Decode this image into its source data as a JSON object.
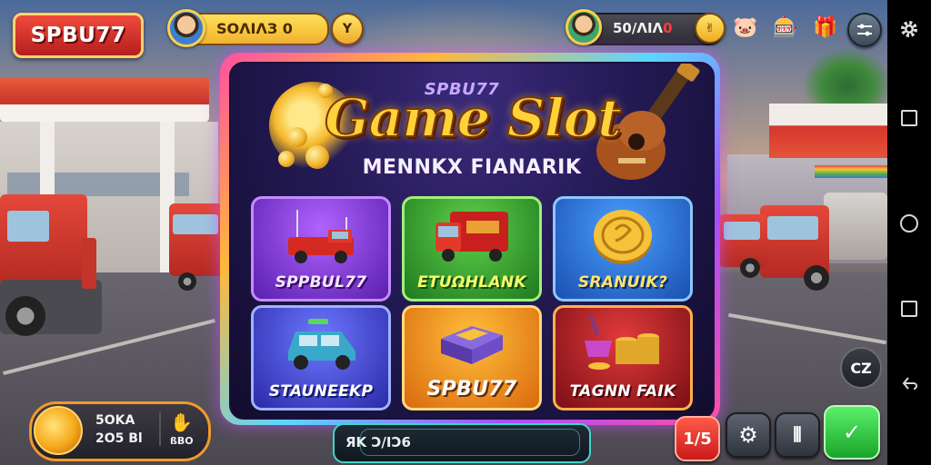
{
  "brand": {
    "logo_text": "SPBU77",
    "panel_brand": "SPBU77"
  },
  "header": {
    "coins": "SOΛΙΛЗ 0",
    "dropdown_glyph": "Y",
    "balance_main": "50/ΛΙΛ",
    "balance_suffix": "0",
    "small_btn_glyph": "✌"
  },
  "top_icons": [
    {
      "name": "piggy-bank-icon",
      "glyph": "🐷"
    },
    {
      "name": "slot-machine-icon",
      "glyph": "🎰"
    },
    {
      "name": "gift-icon",
      "glyph": "🎁"
    }
  ],
  "panel": {
    "title": "Game Slot",
    "subtitle": "MENNKX FIANARIK"
  },
  "tiles": [
    {
      "label": "SPPBUL77",
      "icon": "fire-truck-icon"
    },
    {
      "label": "ETUΩHLANK",
      "icon": "delivery-truck-icon"
    },
    {
      "label": "SRANUIΚ?",
      "icon": "gold-coin-icon"
    },
    {
      "label": "STAUNEEKP",
      "icon": "suv-car-icon"
    },
    {
      "label": "SPBU77",
      "icon": "gold-bar-box-icon"
    },
    {
      "label": "TAGNN FAIK",
      "icon": "coin-stack-icon"
    }
  ],
  "bonus": {
    "line1": "5OKA",
    "line2": "2O5 Bl",
    "line3": "ßBO"
  },
  "chat": {
    "text": "ЯK Ɔ/IƆ6"
  },
  "side_badge": "CZ",
  "bottom_buttons": {
    "red": "1/5",
    "gear": "⚙",
    "bars": "⦀",
    "green": "✓"
  },
  "colors": {
    "accent_gold": "#ffd23a",
    "brand_red": "#d42a22",
    "frame_glow": "#c850ff"
  }
}
